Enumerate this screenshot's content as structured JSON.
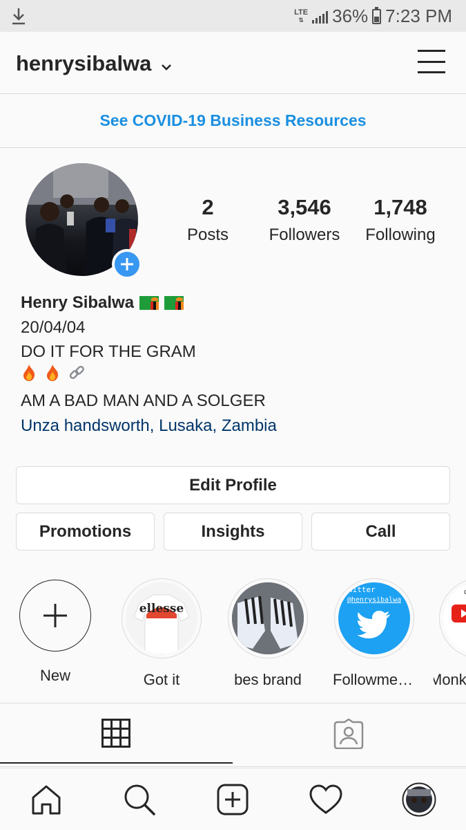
{
  "status_bar": {
    "network": "LTE",
    "battery": "36%",
    "time": "7:23 PM",
    "icons": [
      "download-icon",
      "signal-icon",
      "battery-icon"
    ]
  },
  "header": {
    "username": "henrysibalwa",
    "icons": [
      "chevron-down-icon",
      "menu-icon"
    ]
  },
  "banner": {
    "text": "See COVID-19 Business Resources",
    "color": "#1a8fe0"
  },
  "profile": {
    "stats": [
      {
        "value": "2",
        "label": "Posts"
      },
      {
        "value": "3,546",
        "label": "Followers"
      },
      {
        "value": "1,748",
        "label": "Following"
      }
    ],
    "name": "Henry Sibalwa",
    "bio_lines": [
      "20/04/04",
      "DO IT FOR THE GRAM",
      "AM A BAD MAN AND A SOLGER"
    ],
    "bio_icons": [
      "zambia-flag-icon",
      "fire-icon",
      "link-icon"
    ],
    "location": "Unza handsworth, Lusaka, Zambia",
    "accent": "#3897f0"
  },
  "buttons": {
    "edit_profile": "Edit Profile",
    "promotions": "Promotions",
    "insights": "Insights",
    "call": "Call"
  },
  "highlights": [
    {
      "label": "New",
      "image_text": ""
    },
    {
      "label": "Got it",
      "image_text": "ellesse"
    },
    {
      "label": "bes brand",
      "image_text": ""
    },
    {
      "label": "Followmetwi…",
      "image_text": "@henrysibalwa",
      "image_text_top": "witter"
    },
    {
      "label": "Monk",
      "image_text": "c"
    }
  ],
  "tabs": {
    "icons": [
      "grid-icon",
      "tagged-icon"
    ],
    "active": 0
  },
  "bottom_nav": {
    "icons": [
      "home-icon",
      "search-icon",
      "add-post-icon",
      "heart-icon",
      "profile-avatar"
    ]
  }
}
